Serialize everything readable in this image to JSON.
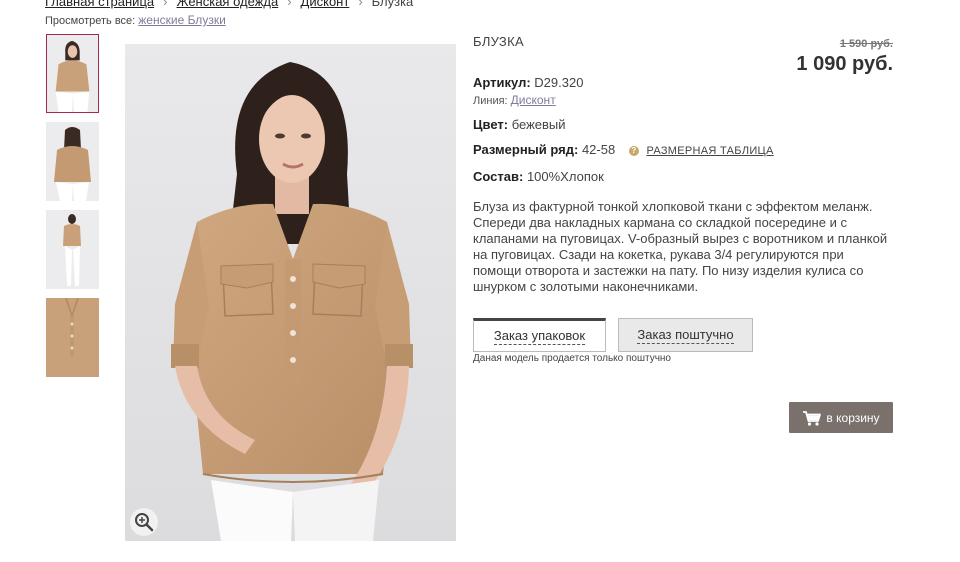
{
  "breadcrumb": {
    "items": [
      "Главная страница",
      "Женская одежда",
      "Дисконт"
    ],
    "separator": "›",
    "current": "Блузка"
  },
  "view_all": {
    "label": "Просмотреть все:",
    "link": "женские Блузки"
  },
  "product": {
    "title": "БЛУЗКА",
    "old_price": "1 590 руб.",
    "price": "1 090 руб.",
    "article_label": "Артикул:",
    "article_value": "D29.320",
    "line_label": "Линия:",
    "line_value": "Дисконт",
    "color_label": "Цвет:",
    "color_value": "бежевый",
    "size_label": "Размерный ряд:",
    "size_value": "42-58",
    "size_table_label": "РАЗМЕРНАЯ ТАБЛИЦА",
    "composition_label": "Состав:",
    "composition_value": "100%Хлопок",
    "description": "Блуза из фактурной тонкой хлопковой ткани с эффектом меланж. Спереди два накладных кармана со складкой посередине и с клапанами на пуговицах. V-образный вырез с воротником и планкой на пуговицах. Сзади на кокетка, рукава 3/4 регулируются при помощи отворота и застежки на пату. По низу изделия кулиса со шнурком с золотыми наконечниками."
  },
  "order": {
    "pack_label": "Заказ упаковок",
    "single_label": "Заказ поштучно",
    "note": "Даная модель продается только поштучно"
  },
  "cart": {
    "label": "в корзину"
  },
  "colors": {
    "accent_border": "#a8264a",
    "cart_bg": "#7a706c",
    "blouse": "#c8a07a"
  }
}
